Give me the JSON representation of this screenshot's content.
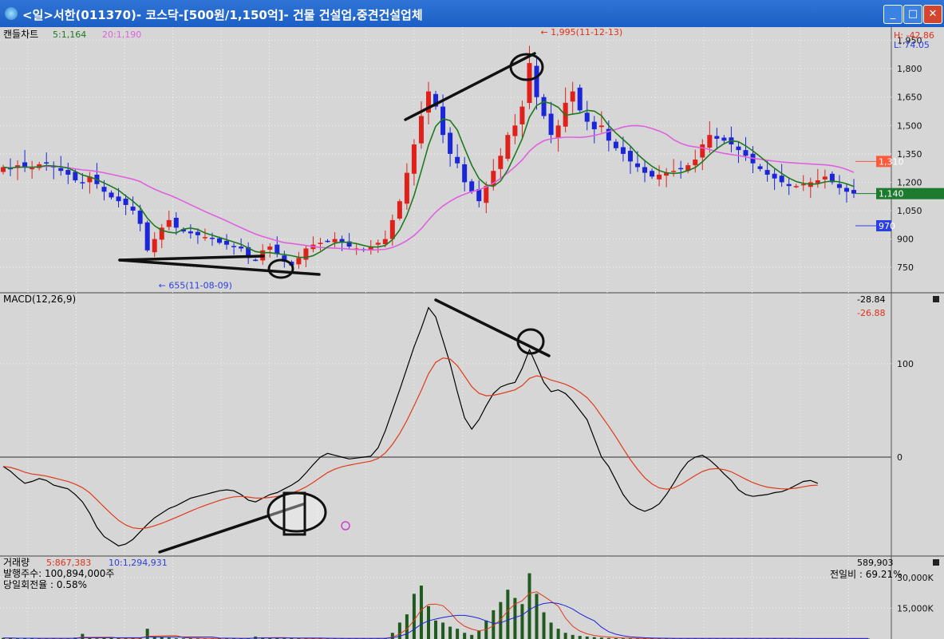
{
  "window": {
    "title": "<일>서한(011370)- 코스닥-[500원/1,150억]- 건물 건설업,중견건설업체",
    "minimize": "_",
    "maximize": "□",
    "close": "✕"
  },
  "colors": {
    "bg": "#d6d6d6",
    "up": "#e0201a",
    "down": "#1a26d8",
    "ma5": "#1e7a1e",
    "ma20": "#e060e0",
    "macd": "#000000",
    "signal": "#e03a1a",
    "vol_bar": "#1f5a1f"
  },
  "chart_data": [
    {
      "type": "candlestick",
      "name": "price",
      "legend": {
        "label": "캔들차트",
        "ma5": "5:1,164",
        "ma20": "20:1,190"
      },
      "info_hi": "H: -42.86",
      "info_lo": "L: 74.05",
      "yticks": [
        750,
        900,
        1050,
        1200,
        1350,
        1500,
        1650,
        1800,
        1950
      ],
      "ytick_labels": [
        "750",
        "900",
        "1,050",
        "1,200",
        "1,350",
        "1,500",
        "1,650",
        "1,800",
        "1,950"
      ],
      "ylim": [
        620,
        2020
      ],
      "badges": [
        {
          "label": "1,310",
          "value": 1310,
          "color": "#ff5a3c"
        },
        {
          "label": "1,140",
          "value": 1140,
          "color": "#1d7a2f"
        },
        {
          "label": "970",
          "value": 970,
          "color": "#2a40e0"
        }
      ],
      "annotations": [
        {
          "text": "← 1,995(11-12-13)",
          "x_index": 73,
          "value": 1995,
          "color": "#e0301a"
        },
        {
          "text": "← 655(11-08-09)",
          "x_index": 20,
          "value": 655,
          "color": "#2a40e0"
        }
      ],
      "close": [
        1280,
        1270,
        1290,
        1280,
        1275,
        1295,
        1300,
        1280,
        1260,
        1240,
        1210,
        1200,
        1230,
        1190,
        1150,
        1120,
        1100,
        1080,
        1050,
        980,
        840,
        900,
        960,
        1000,
        960,
        940,
        930,
        920,
        910,
        900,
        880,
        870,
        860,
        850,
        800,
        790,
        840,
        860,
        820,
        780,
        760,
        800,
        850,
        870,
        880,
        890,
        900,
        880,
        860,
        850,
        840,
        860,
        880,
        900,
        1000,
        1100,
        1250,
        1400,
        1550,
        1680,
        1600,
        1450,
        1350,
        1300,
        1200,
        1150,
        1100,
        1180,
        1260,
        1340,
        1450,
        1500,
        1600,
        1830,
        1650,
        1550,
        1450,
        1500,
        1620,
        1680,
        1580,
        1520,
        1480,
        1500,
        1420,
        1380,
        1350,
        1310,
        1280,
        1250,
        1230,
        1240,
        1250,
        1260,
        1270,
        1290,
        1320,
        1400,
        1450,
        1430,
        1420,
        1400,
        1370,
        1340,
        1300,
        1270,
        1240,
        1220,
        1200,
        1180,
        1180,
        1190,
        1200,
        1210,
        1230,
        1200,
        1170,
        1150,
        1140
      ]
    },
    {
      "type": "line",
      "name": "MACD",
      "legend": {
        "label": "MACD(12,26,9)"
      },
      "values_label": {
        "macd": "-28.84",
        "signal": "-26.88"
      },
      "yticks": [
        0,
        100
      ],
      "ytick_labels": [
        "0",
        "100"
      ],
      "ylim": [
        -105,
        175
      ],
      "macd": [
        -10,
        -15,
        -22,
        -28,
        -26,
        -23,
        -25,
        -30,
        -32,
        -34,
        -40,
        -48,
        -60,
        -75,
        -85,
        -90,
        -95,
        -93,
        -88,
        -80,
        -72,
        -65,
        -60,
        -55,
        -52,
        -48,
        -44,
        -42,
        -40,
        -38,
        -36,
        -35,
        -36,
        -40,
        -46,
        -48,
        -44,
        -40,
        -38,
        -34,
        -30,
        -25,
        -17,
        -8,
        0,
        4,
        2,
        0,
        -2,
        -1,
        0,
        1,
        10,
        28,
        50,
        72,
        95,
        118,
        138,
        160,
        150,
        125,
        100,
        70,
        42,
        30,
        40,
        55,
        68,
        75,
        78,
        80,
        95,
        115,
        98,
        80,
        70,
        72,
        68,
        60,
        50,
        40,
        20,
        0,
        -10,
        -25,
        -40,
        -50,
        -55,
        -58,
        -55,
        -50,
        -40,
        -28,
        -15,
        -5,
        0,
        2,
        -3,
        -10,
        -18,
        -25,
        -35,
        -40,
        -42,
        -41,
        -40,
        -38,
        -37,
        -34,
        -30,
        -26,
        -25,
        -28
      ]
    },
    {
      "type": "bar",
      "name": "volume",
      "legend": {
        "label": "거래량",
        "ma5": "5:867,383",
        "ma10": "10:1,294,931"
      },
      "shares": "발행주수:  100,894,000주",
      "turnover": "당일회전율 : 0.58%",
      "last_value": "589,903",
      "prev_ratio": "전일비 : 69.21%",
      "yticks": [
        15000,
        30000
      ],
      "ytick_labels": [
        "15,000K",
        "30,000K"
      ],
      "ylim": [
        0,
        40000
      ],
      "values": [
        500,
        400,
        300,
        400,
        300,
        200,
        300,
        500,
        200,
        300,
        700,
        2500,
        400,
        300,
        600,
        500,
        400,
        300,
        200,
        300,
        5000,
        1200,
        800,
        700,
        400,
        300,
        400,
        300,
        200,
        300,
        500,
        400,
        300,
        200,
        400,
        1200,
        800,
        600,
        400,
        300,
        400,
        300,
        200,
        300,
        200,
        300,
        400,
        300,
        200,
        300,
        200,
        300,
        400,
        500,
        3000,
        8000,
        12000,
        22000,
        26000,
        16000,
        9000,
        8000,
        6000,
        5000,
        3000,
        2000,
        4000,
        9000,
        14000,
        18000,
        24000,
        20000,
        17000,
        32000,
        22000,
        13000,
        8000,
        5000,
        3000,
        2000,
        1500,
        1200,
        900,
        700,
        500,
        400,
        300,
        300,
        200,
        300,
        300,
        400,
        300,
        300,
        200,
        200,
        300,
        300,
        400,
        300,
        200,
        300,
        300,
        200,
        300,
        300,
        200,
        300,
        200,
        300,
        200,
        200,
        300,
        200,
        300,
        200,
        200,
        300,
        200,
        200,
        200
      ]
    }
  ]
}
